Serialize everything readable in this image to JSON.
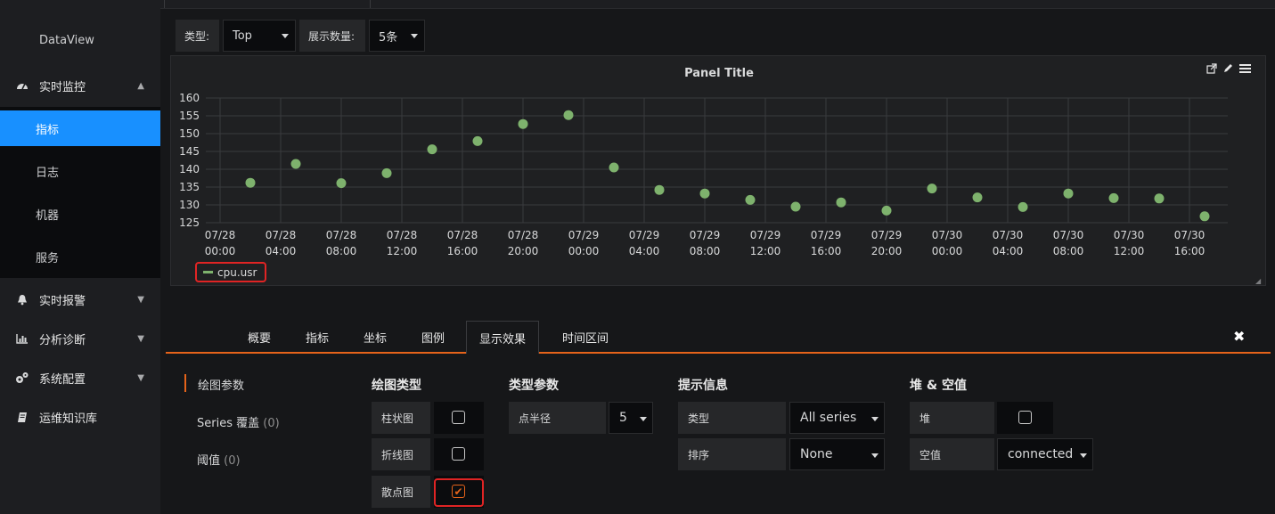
{
  "sidebar": {
    "brand": "DataView",
    "groups": [
      {
        "label": "实时监控",
        "icon": "dashboard-icon"
      },
      {
        "label": "实时报警",
        "icon": "bell-icon"
      },
      {
        "label": "分析诊断",
        "icon": "bar-chart-icon"
      },
      {
        "label": "系统配置",
        "icon": "cogs-icon"
      },
      {
        "label": "运维知识库",
        "icon": "book-icon"
      }
    ],
    "submenu": [
      {
        "label": "指标",
        "active": true
      },
      {
        "label": "日志"
      },
      {
        "label": "机器"
      },
      {
        "label": "服务"
      }
    ]
  },
  "controls": {
    "type_label": "类型:",
    "type_value": "Top",
    "count_label": "展示数量:",
    "count_value": "5条"
  },
  "panel": {
    "title": "Panel Title",
    "legend_series": "cpu.usr"
  },
  "chart_data": {
    "type": "scatter",
    "title": "Panel Title",
    "series": [
      {
        "name": "cpu.usr",
        "color": "#7eb26d",
        "points": [
          [
            "07/28 02:00",
            136.2
          ],
          [
            "07/28 05:00",
            141.5
          ],
          [
            "07/28 08:00",
            136.1
          ],
          [
            "07/28 11:00",
            138.9
          ],
          [
            "07/28 14:00",
            145.6
          ],
          [
            "07/28 17:00",
            147.9
          ],
          [
            "07/28 20:00",
            152.7
          ],
          [
            "07/28 23:00",
            155.2
          ],
          [
            "07/29 02:00",
            140.5
          ],
          [
            "07/29 05:00",
            134.2
          ],
          [
            "07/29 08:00",
            133.2
          ],
          [
            "07/29 11:00",
            131.4
          ],
          [
            "07/29 14:00",
            129.5
          ],
          [
            "07/29 17:00",
            130.7
          ],
          [
            "07/29 20:00",
            128.4
          ],
          [
            "07/29 23:00",
            134.6
          ],
          [
            "07/30 02:00",
            132.1
          ],
          [
            "07/30 05:00",
            129.4
          ],
          [
            "07/30 08:00",
            133.2
          ],
          [
            "07/30 11:00",
            131.9
          ],
          [
            "07/30 14:00",
            131.8
          ],
          [
            "07/30 17:00",
            126.8
          ]
        ]
      }
    ],
    "xlabel": "",
    "ylabel": "",
    "ylim": [
      125,
      160
    ],
    "yticks": [
      125,
      130,
      135,
      140,
      145,
      150,
      155,
      160
    ],
    "xticks": [
      [
        "07/28",
        "00:00"
      ],
      [
        "07/28",
        "04:00"
      ],
      [
        "07/28",
        "08:00"
      ],
      [
        "07/28",
        "12:00"
      ],
      [
        "07/28",
        "16:00"
      ],
      [
        "07/28",
        "20:00"
      ],
      [
        "07/29",
        "00:00"
      ],
      [
        "07/29",
        "04:00"
      ],
      [
        "07/29",
        "08:00"
      ],
      [
        "07/29",
        "12:00"
      ],
      [
        "07/29",
        "16:00"
      ],
      [
        "07/29",
        "20:00"
      ],
      [
        "07/30",
        "00:00"
      ],
      [
        "07/30",
        "04:00"
      ],
      [
        "07/30",
        "08:00"
      ],
      [
        "07/30",
        "12:00"
      ],
      [
        "07/30",
        "16:00"
      ]
    ],
    "grid": true,
    "legend": "bottom-left"
  },
  "editor": {
    "tabs": [
      {
        "label": "概要"
      },
      {
        "label": "指标"
      },
      {
        "label": "坐标"
      },
      {
        "label": "图例"
      },
      {
        "label": "显示效果",
        "active": true
      },
      {
        "label": "时间区间"
      }
    ],
    "sections": [
      {
        "label": "绘图参数",
        "active": true
      },
      {
        "label": "Series 覆盖",
        "count": "(0)"
      },
      {
        "label": "阈值",
        "count": "(0)"
      }
    ],
    "draw_type": {
      "title": "绘图类型",
      "bar": {
        "label": "柱状图",
        "checked": false
      },
      "line": {
        "label": "折线图",
        "checked": false
      },
      "points": {
        "label": "散点图",
        "checked": true
      }
    },
    "type_params": {
      "title": "类型参数",
      "point_radius_label": "点半径",
      "point_radius_value": "5"
    },
    "tooltip": {
      "title": "提示信息",
      "mode_label": "类型",
      "mode_value": "All series",
      "sort_label": "排序",
      "sort_value": "None"
    },
    "stack_null": {
      "title": "堆 & 空值",
      "stack_label": "堆",
      "stack_checked": false,
      "null_label": "空值",
      "null_value": "connected"
    }
  }
}
